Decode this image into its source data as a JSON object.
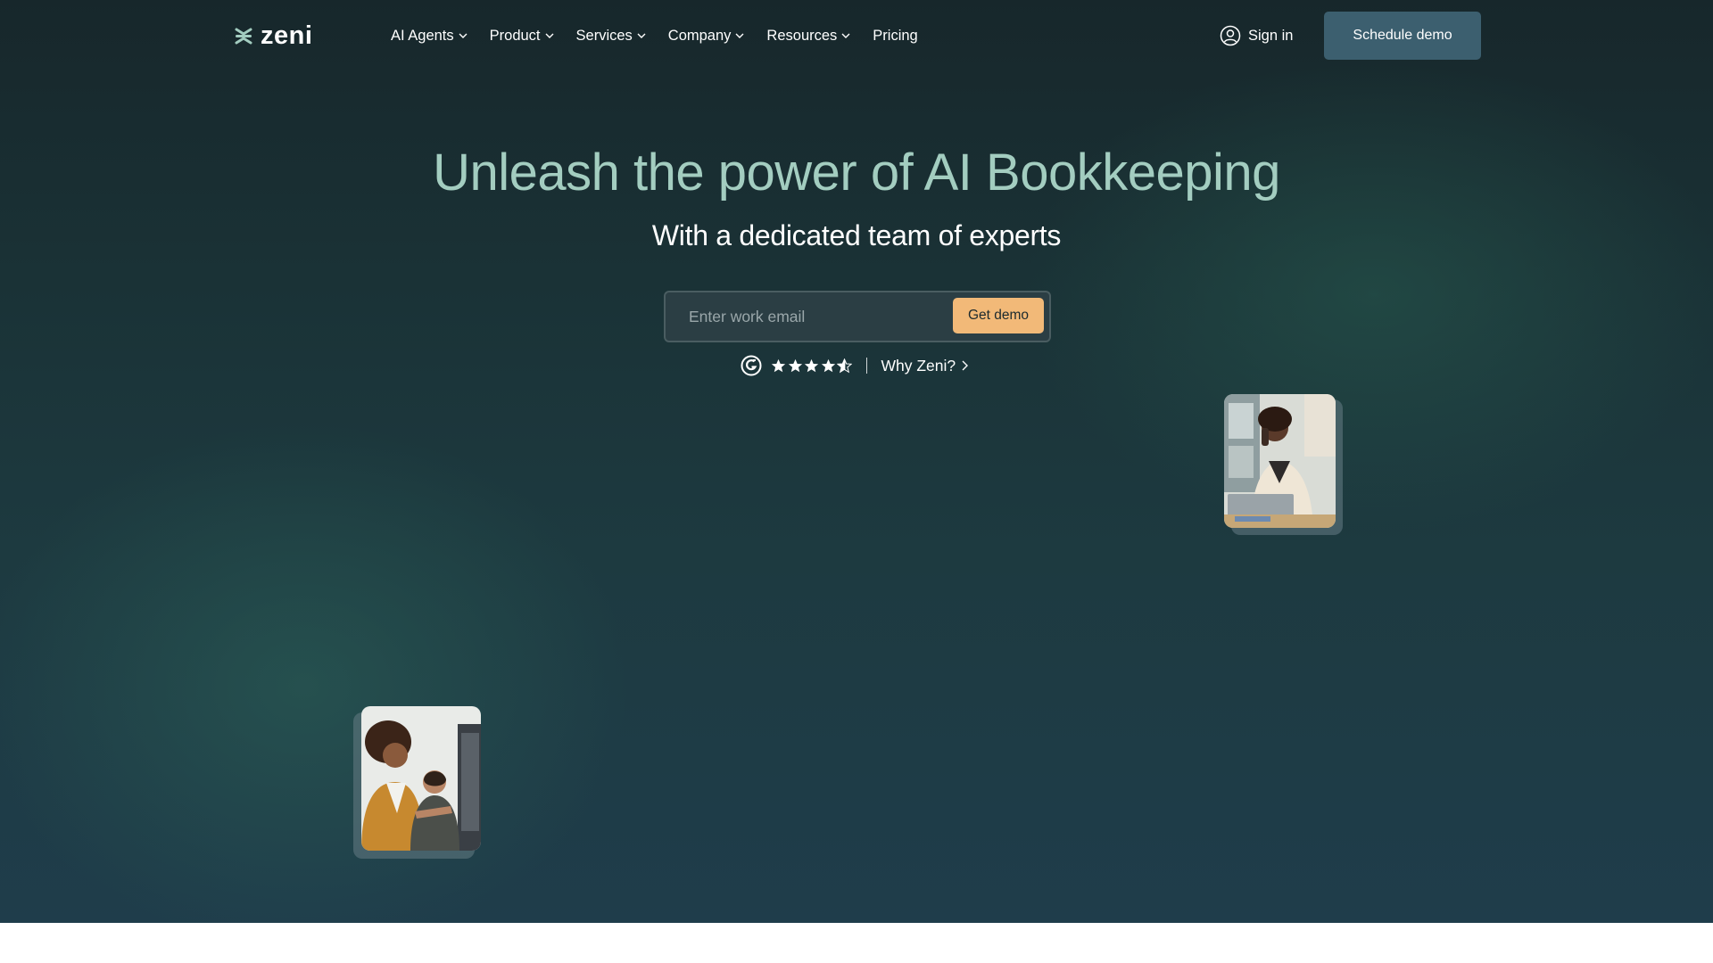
{
  "brand": {
    "name": "zeni"
  },
  "nav": {
    "items": [
      {
        "label": "AI Agents",
        "has_dropdown": true
      },
      {
        "label": "Product",
        "has_dropdown": true
      },
      {
        "label": "Services",
        "has_dropdown": true
      },
      {
        "label": "Company",
        "has_dropdown": true
      },
      {
        "label": "Resources",
        "has_dropdown": true
      },
      {
        "label": "Pricing",
        "has_dropdown": false
      }
    ],
    "signin_label": "Sign in",
    "schedule_label": "Schedule demo"
  },
  "hero": {
    "title": "Unleash the power of AI Bookkeeping",
    "subtitle": "With a dedicated team of experts",
    "email_placeholder": "Enter work email",
    "email_value": "",
    "cta_label": "Get demo",
    "rating_stars": 4.5,
    "why_label": "Why Zeni?"
  },
  "colors": {
    "title": "#a3cdc0",
    "cta": "#f2b978",
    "schedule_button": "#3c5f6f",
    "hero_bg": "#1b3438"
  },
  "icons": {
    "logo": "zeni-logo-icon",
    "dropdown": "chevron-down-icon",
    "user": "user-circle-icon",
    "review": "g2-logo-icon",
    "star": "star-icon",
    "arrow": "chevron-right-icon"
  }
}
